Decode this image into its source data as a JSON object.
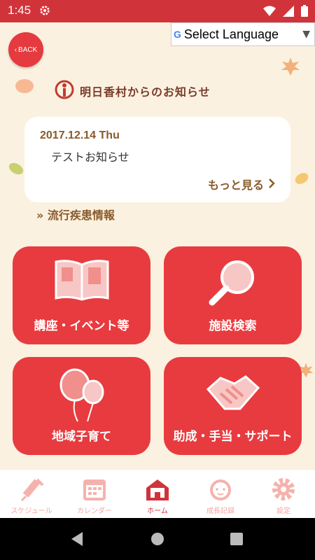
{
  "status_bar": {
    "time": "1:45"
  },
  "header": {
    "back_label": "BACK",
    "language_label": "Select Language",
    "google_mark": "G",
    "title": "明日香村からのお知らせ"
  },
  "news": {
    "date": "2017.12.14 Thu",
    "text": "テストお知らせ",
    "more_label": "もっと見る"
  },
  "epidemic_link": "流行疾患情報",
  "tiles": [
    {
      "label": "講座・イベント等",
      "icon": "book-icon"
    },
    {
      "label": "施設検索",
      "icon": "magnifier-icon"
    },
    {
      "label": "地域子育て",
      "icon": "balloon-icon"
    },
    {
      "label": "助成・手当・サポート",
      "icon": "handshake-icon"
    }
  ],
  "tabs": [
    {
      "label": "スケジュール",
      "icon": "syringe-icon"
    },
    {
      "label": "カレンダー",
      "icon": "calendar-icon"
    },
    {
      "label": "ホーム",
      "icon": "home-icon",
      "active": true
    },
    {
      "label": "成長記録",
      "icon": "baby-face-icon"
    },
    {
      "label": "設定",
      "icon": "gear-icon"
    }
  ],
  "colors": {
    "accent": "#d1333a",
    "tile": "#e83b3f",
    "background": "#fbf1e0",
    "text_brown": "#8a5a2a"
  }
}
